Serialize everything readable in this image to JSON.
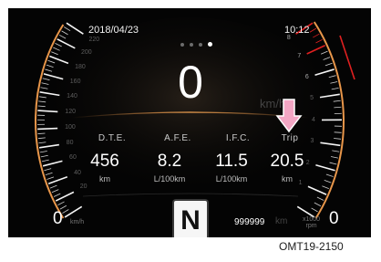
{
  "cluster": {
    "date": "2018/04/23",
    "clock": "10:12",
    "page_indicator": {
      "count": 4,
      "active_index": 3
    },
    "speed": "0",
    "speed_unit": "km/h",
    "speed_zero_label": "0",
    "speedometer_ticks": [
      "220",
      "200",
      "180",
      "160",
      "140",
      "120",
      "100",
      "80",
      "60",
      "40",
      "20"
    ],
    "tachometer_ticks": [
      "8",
      "7",
      "6",
      "5",
      "4",
      "3",
      "2",
      "1"
    ],
    "tach_zero_label": "0",
    "tach_unit_line1": "x1000",
    "tach_unit_line2": "rpm",
    "trip_columns": [
      {
        "label": "D.T.E.",
        "value": "456",
        "unit": "km"
      },
      {
        "label": "A.F.E.",
        "value": "8.2",
        "unit": "L/100km"
      },
      {
        "label": "I.F.C.",
        "value": "11.5",
        "unit": "L/100km"
      },
      {
        "label": "Trip",
        "value": "20.5",
        "unit": "km"
      }
    ],
    "gear": "N",
    "odometer": "999999",
    "odometer_unit": "km",
    "annotation_arrow": "down-arrow-icon"
  },
  "caption": "OMT19-2150",
  "colors": {
    "background": "#040404",
    "accent_amber": "#e8964a",
    "redline": "#e02020",
    "arrow_pink": "#f3a6c4"
  }
}
